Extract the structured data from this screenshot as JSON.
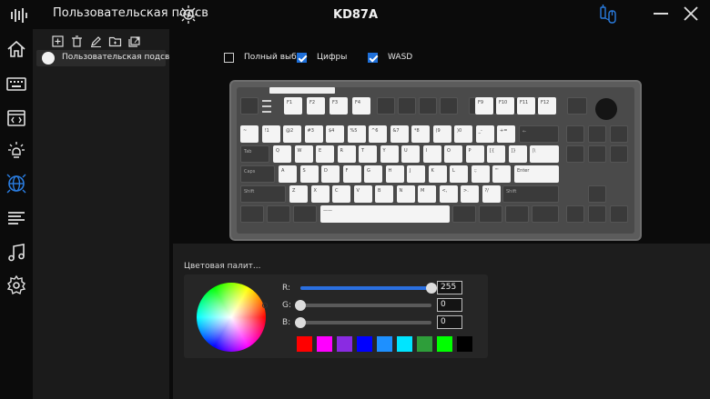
{
  "titlebar": {
    "profile_name": "Пользовательская подсв",
    "device": "KD87A"
  },
  "profile_panel": {
    "items": [
      {
        "label": "Пользовательская подсв"
      }
    ]
  },
  "options": [
    {
      "label": "Полный выб",
      "checked": false
    },
    {
      "label": "Цифры",
      "checked": true
    },
    {
      "label": "WASD",
      "checked": true
    }
  ],
  "keyboard": {
    "f_row": [
      "",
      "F1",
      "F2",
      "F3",
      "F4",
      "",
      "",
      "",
      "",
      "F9",
      "F10",
      "F11",
      "F12",
      ""
    ],
    "num_row": [
      "~",
      "!1",
      "@2",
      "#3",
      "$4",
      "%5",
      "^6",
      "&7",
      "*8",
      "(9",
      ")0",
      "_-",
      "+=",
      "←"
    ],
    "q_row": [
      "Tab",
      "Q",
      "W",
      "E",
      "R",
      "T",
      "Y",
      "U",
      "I",
      "O",
      "P",
      "[{",
      "]}",
      "|\\"
    ],
    "a_row": [
      "Caps",
      "A",
      "S",
      "D",
      "F",
      "G",
      "H",
      "J",
      "K",
      "L",
      ":;",
      "\"'",
      "Enter"
    ],
    "z_row": [
      "Shift",
      "Z",
      "X",
      "C",
      "V",
      "B",
      "N",
      "M",
      "<,",
      ">.",
      "?/",
      "Shift"
    ]
  },
  "palette": {
    "title": "Цветовая палит...",
    "channels": [
      {
        "label": "R:",
        "value": "255",
        "level": 1.0
      },
      {
        "label": "G:",
        "value": "0",
        "level": 0.0
      },
      {
        "label": "B:",
        "value": "0",
        "level": 0.0
      }
    ],
    "swatches": [
      "#ff0000",
      "#ff00ff",
      "#8a2be2",
      "#0000ff",
      "#1e90ff",
      "#00e5ff",
      "#2e9e3a",
      "#00ff00",
      "#000000"
    ]
  },
  "colors": {
    "accent": "#1e6fd9",
    "nav_active": "#2a7de1"
  },
  "icons": [
    "app-logo-icon",
    "sun-icon",
    "device-icon",
    "minimize-icon",
    "close-icon",
    "home-icon",
    "keyboard-icon",
    "macro-icon",
    "brightness-icon",
    "globe-icon",
    "list-icon",
    "music-icon",
    "gear-icon",
    "add-icon",
    "delete-icon",
    "edit-icon",
    "folder-icon",
    "export-icon"
  ]
}
